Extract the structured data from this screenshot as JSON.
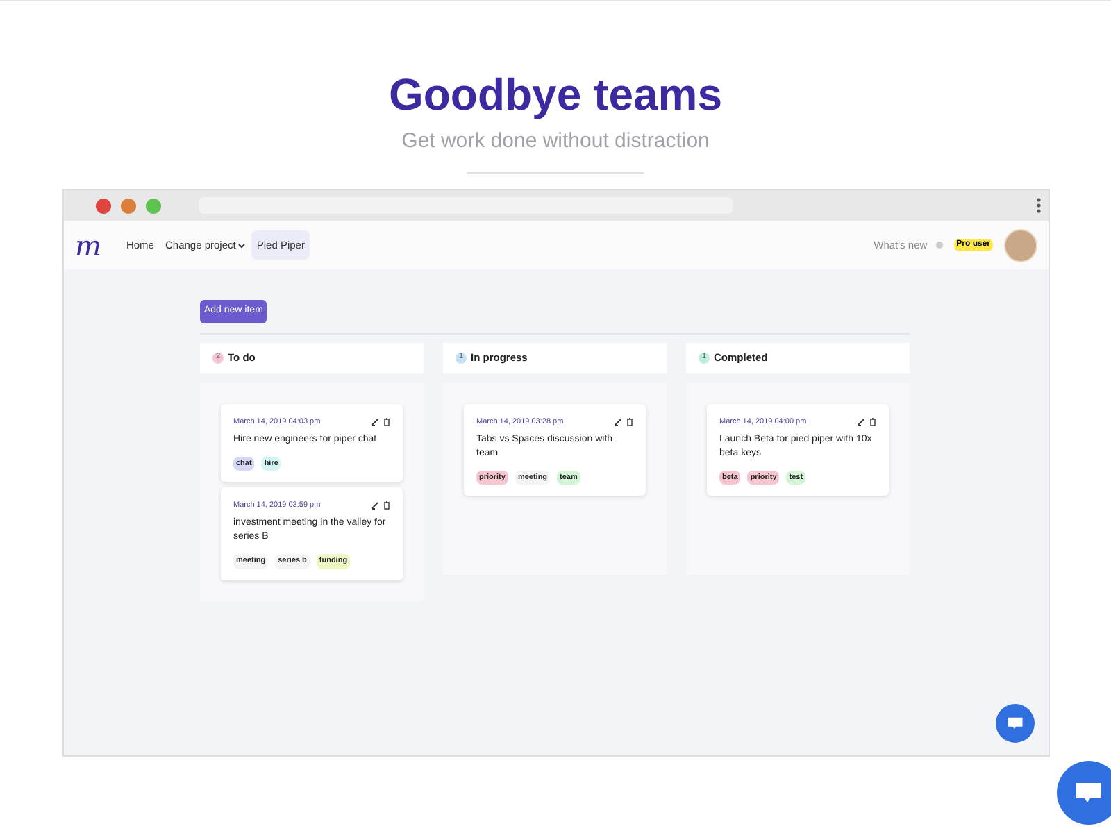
{
  "hero": {
    "title": "Goodbye teams",
    "subtitle": "Get work done without distraction"
  },
  "browser": {
    "dots": [
      {
        "color": "#e0443e"
      },
      {
        "color": "#dd7f3c"
      },
      {
        "color": "#5fc350"
      }
    ]
  },
  "nav": {
    "logo": "m",
    "links": [
      {
        "label": "Home",
        "kind": "link",
        "selected": false
      },
      {
        "label": "Change project",
        "kind": "dropdown",
        "selected": false
      },
      {
        "label": "Pied Piper",
        "kind": "link",
        "selected": true
      }
    ],
    "whats_new": "What's new",
    "badge": "Pro user"
  },
  "add_button": "Add new item",
  "columns": [
    {
      "title": "To do",
      "count": "2",
      "color": "#f5c6d6",
      "cards": [
        {
          "date": "March 14, 2019 04:03 pm",
          "text": "Hire new engineers for piper chat",
          "tags": [
            {
              "label": "chat",
              "color": "#d6d6f5"
            },
            {
              "label": "hire",
              "color": "#d2f5f3"
            }
          ]
        },
        {
          "date": "March 14, 2019 03:59 pm",
          "text": "investment meeting in the valley for series B",
          "tags": [
            {
              "label": "meeting",
              "color": "#f4f4f6"
            },
            {
              "label": "series b",
              "color": "#f4f4f6"
            },
            {
              "label": "funding",
              "color": "#eef7c4"
            }
          ]
        }
      ]
    },
    {
      "title": "In progress",
      "count": "1",
      "color": "#c6e3f5",
      "cards": [
        {
          "date": "March 14, 2019 03:28 pm",
          "text": "Tabs vs Spaces discussion with team",
          "tags": [
            {
              "label": "priority",
              "color": "#f5c6d0"
            },
            {
              "label": "meeting",
              "color": "#f4f4f6"
            },
            {
              "label": "team",
              "color": "#d4f5d6"
            }
          ]
        }
      ]
    },
    {
      "title": "Completed",
      "count": "1",
      "color": "#bfeee3",
      "cards": [
        {
          "date": "March 14, 2019 04:00 pm",
          "text": "Launch Beta for pied piper with 10x beta keys",
          "tags": [
            {
              "label": "beta",
              "color": "#f5c6d0"
            },
            {
              "label": "priority",
              "color": "#f5c6d0"
            },
            {
              "label": "test",
              "color": "#d4f5d6"
            }
          ]
        }
      ]
    }
  ]
}
